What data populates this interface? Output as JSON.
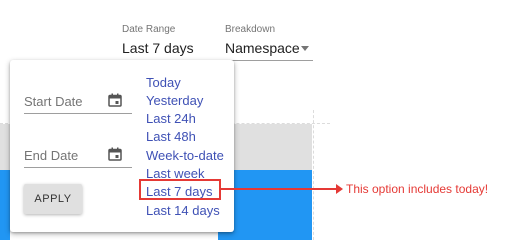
{
  "filters": {
    "date_range": {
      "label": "Date Range",
      "value": "Last 7 days"
    },
    "breakdown": {
      "label": "Breakdown",
      "value": "Namespace"
    }
  },
  "picker": {
    "start_date_label": "Start Date",
    "end_date_label": "End Date",
    "apply_label": "APPLY",
    "presets": [
      "Today",
      "Yesterday",
      "Last 24h",
      "Last 48h",
      "Week-to-date",
      "Last week",
      "Last 7 days",
      "Last 14 days"
    ],
    "highlighted_preset": "Last 7 days"
  },
  "annotation": {
    "text": "This option includes today!"
  },
  "colors": {
    "accent": "#3f51b5",
    "bar": "#2196f3",
    "highlight": "#e53935"
  }
}
